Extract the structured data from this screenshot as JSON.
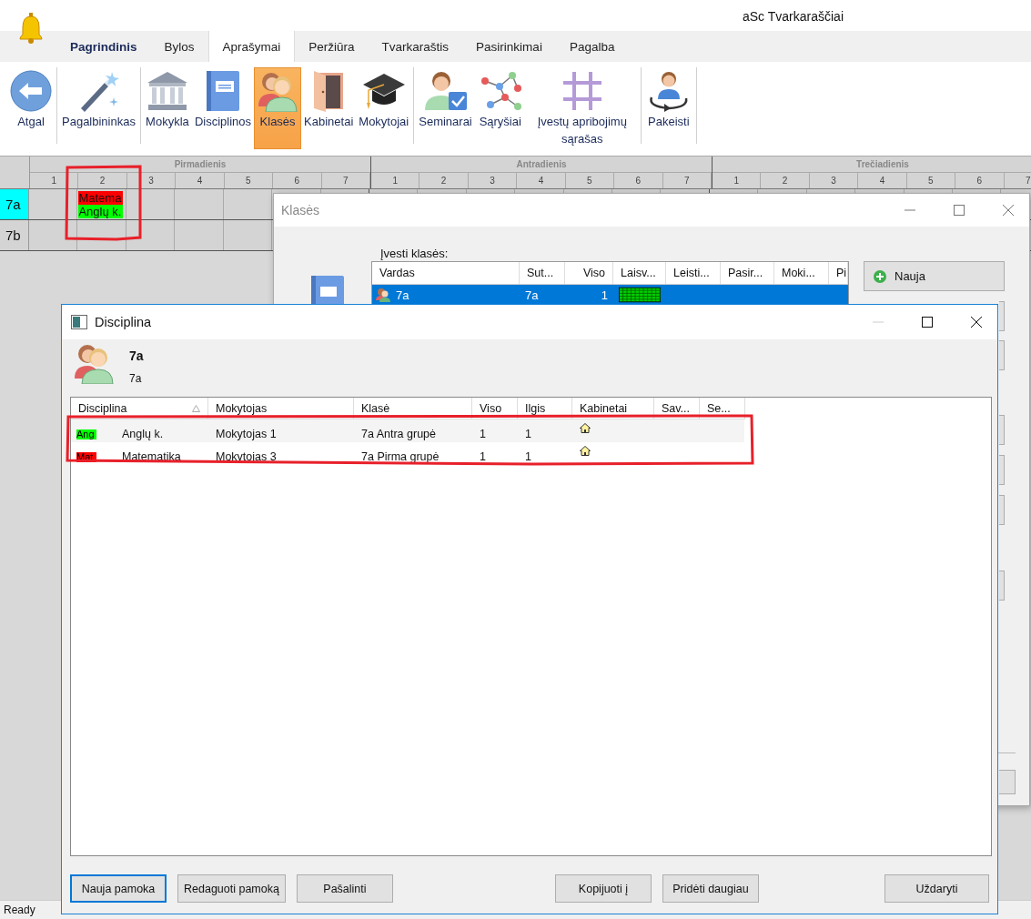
{
  "app": {
    "title": "aSc Tvarkaraščiai"
  },
  "tabs": [
    {
      "label": "Pagrindinis",
      "kind": "main",
      "selected": false
    },
    {
      "label": "Bylos",
      "kind": "tab",
      "selected": false
    },
    {
      "label": "Aprašymai",
      "kind": "tab",
      "selected": true
    },
    {
      "label": "Peržiūra",
      "kind": "tab",
      "selected": false
    },
    {
      "label": "Tvarkaraštis",
      "kind": "tab",
      "selected": false
    },
    {
      "label": "Pasirinkimai",
      "kind": "tab",
      "selected": false
    },
    {
      "label": "Pagalba",
      "kind": "tab",
      "selected": false
    }
  ],
  "ribbon": {
    "groups": [
      {
        "items": [
          {
            "label": "Atgal",
            "kind": "back",
            "selected": false
          }
        ]
      },
      {
        "items": [
          {
            "label": "Pagalbininkas",
            "kind": "wand",
            "selected": false
          }
        ]
      },
      {
        "items": [
          {
            "label": "Mokykla",
            "kind": "school",
            "selected": false
          },
          {
            "label": "Disciplinos",
            "kind": "book",
            "selected": false
          },
          {
            "label": "Klasės",
            "kind": "people",
            "selected": true
          },
          {
            "label": "Kabinetai",
            "kind": "door",
            "selected": false
          },
          {
            "label": "Mokytojai",
            "kind": "cap",
            "selected": false
          }
        ]
      },
      {
        "items": [
          {
            "label": "Seminarai",
            "kind": "seminar",
            "selected": false
          },
          {
            "label": "Sąryšiai",
            "kind": "network",
            "selected": false
          },
          {
            "label": "Įvestų apribojimų sąrašas",
            "kind": "lattice",
            "selected": false
          }
        ]
      },
      {
        "items": [
          {
            "label": "Pakeisti",
            "kind": "swap",
            "selected": false
          }
        ]
      }
    ]
  },
  "timetable": {
    "days": [
      {
        "name": "Pirmadienis",
        "periods": [
          "1",
          "2",
          "3",
          "4",
          "5",
          "6",
          "7"
        ]
      },
      {
        "name": "Antradienis",
        "periods": [
          "1",
          "2",
          "3",
          "4",
          "5",
          "6",
          "7"
        ]
      },
      {
        "name": "Trečiadienis",
        "periods": [
          "1",
          "2",
          "3",
          "4",
          "5",
          "6",
          "7"
        ]
      }
    ],
    "rows": [
      {
        "name": "7a",
        "selected": true,
        "cells": [
          null,
          {
            "lessons": [
              {
                "label": "Matema",
                "color": "#ff0000"
              },
              {
                "label": "Anglų k.",
                "color": "#00ff00"
              }
            ]
          },
          null,
          null,
          null,
          null,
          null,
          null,
          null,
          null,
          null,
          null,
          null,
          null,
          null,
          null,
          null,
          null,
          null,
          null,
          null
        ]
      },
      {
        "name": "7b",
        "selected": false,
        "cells": [
          null,
          null,
          null,
          null,
          null,
          null,
          null,
          null,
          null,
          null,
          null,
          null,
          null,
          null,
          null,
          null,
          null,
          null,
          null,
          null,
          null
        ]
      }
    ]
  },
  "classes_window": {
    "title": "Klasės",
    "prompt": "Įvesti klasės:",
    "columns": [
      "Vardas",
      "Sut...",
      "Viso",
      "Laisv...",
      "Leisti...",
      "Pasir...",
      "Moki...",
      "Pi"
    ],
    "rows": [
      {
        "name": "7a",
        "short": "7a",
        "total": "1",
        "selected": true
      }
    ],
    "new_button": "Nauja"
  },
  "subject_window": {
    "title": "Disciplina",
    "class_name": "7a",
    "class_short": "7a",
    "columns": [
      {
        "label": "Disciplina",
        "sorted": true
      },
      {
        "label": "Mokytojas",
        "sorted": false
      },
      {
        "label": "Klasė",
        "sorted": false
      },
      {
        "label": "Viso",
        "sorted": false
      },
      {
        "label": "Ilgis",
        "sorted": false
      },
      {
        "label": "Kabinetai",
        "sorted": false
      },
      {
        "label": "Sav...",
        "sorted": false
      },
      {
        "label": "Se...",
        "sorted": false
      }
    ],
    "rows": [
      {
        "chip": "Ang",
        "color": "#00ff00",
        "subject": "Anglų k.",
        "teacher": "Mokytojas 1",
        "class": "7a Antra grupė",
        "total": "1",
        "length": "1",
        "room": true
      },
      {
        "chip": "Mat",
        "color": "#ff0000",
        "subject": "Matematika",
        "teacher": "Mokytojas 3",
        "class": "7a Pirma grupė",
        "total": "1",
        "length": "1",
        "room": true
      }
    ],
    "buttons_left": [
      {
        "label": "Nauja pamoka",
        "default": true
      },
      {
        "label": "Redaguoti pamoką",
        "default": false
      },
      {
        "label": "Pašalinti",
        "default": false
      }
    ],
    "buttons_center": [
      {
        "label": "Kopijuoti į",
        "default": false
      },
      {
        "label": "Pridėti daugiau",
        "default": false
      }
    ],
    "buttons_right": [
      {
        "label": "Uždaryti",
        "default": false
      }
    ]
  },
  "status_bar": {
    "text": "Ready"
  }
}
